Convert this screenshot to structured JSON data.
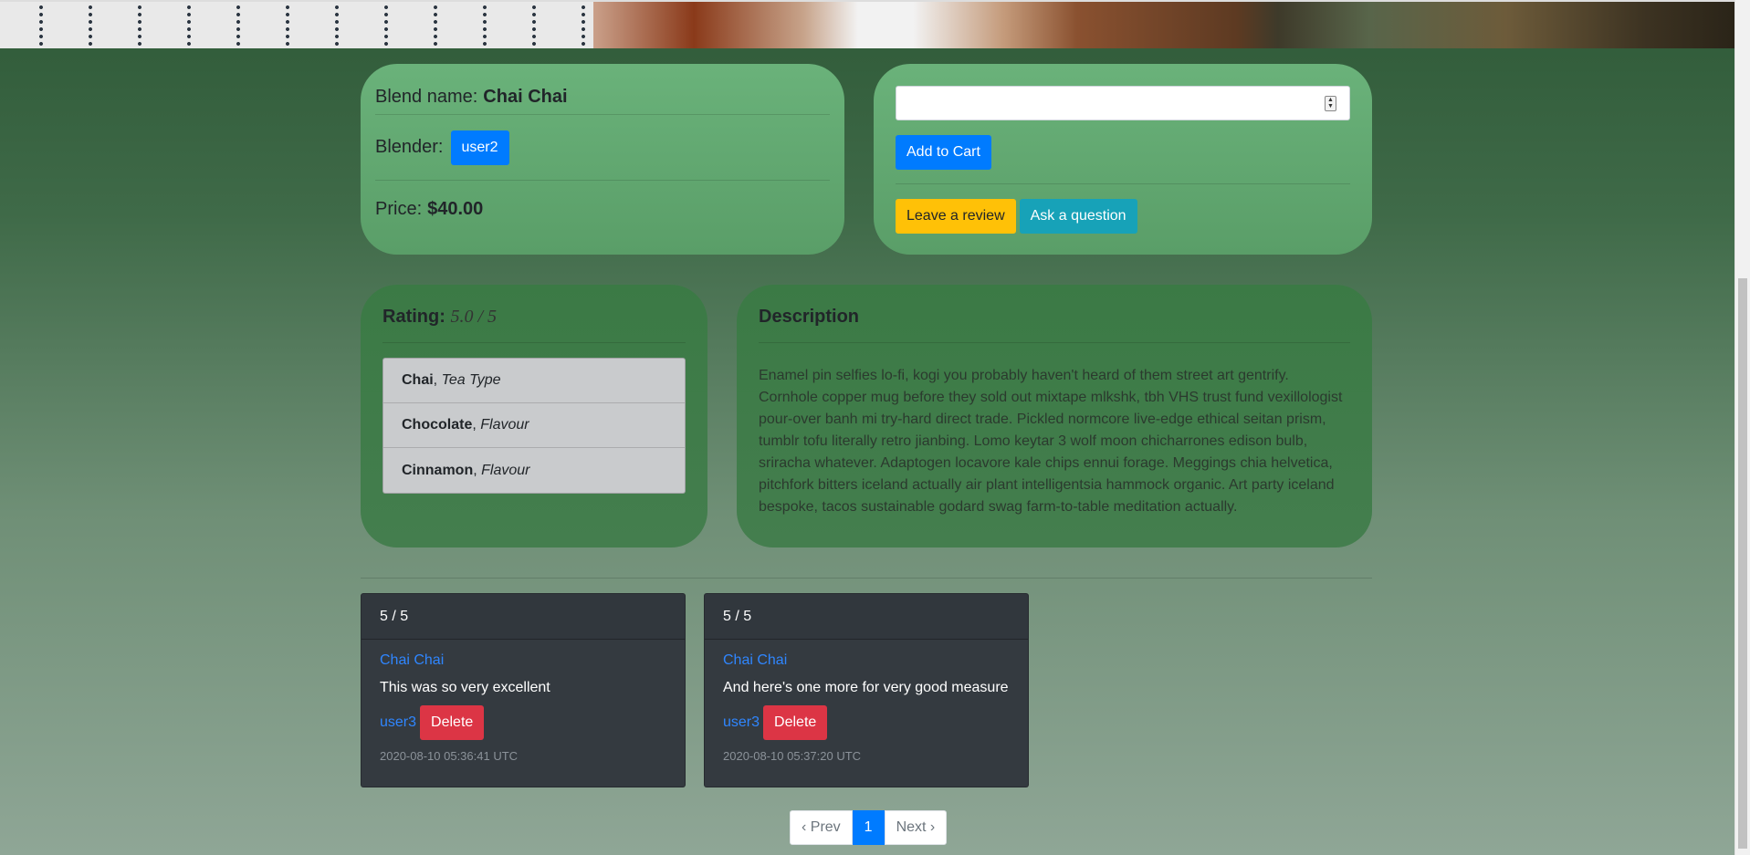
{
  "blend": {
    "name_label": "Blend name:",
    "name": "Chai Chai",
    "blender_label": "Blender:",
    "blender": "user2",
    "price_label": "Price:",
    "price": "$40.00"
  },
  "cart": {
    "quantity_value": "",
    "add_label": "Add to Cart",
    "review_label": "Leave a review",
    "question_label": "Ask a question"
  },
  "rating": {
    "label": "Rating",
    "value": "5.0 / 5",
    "flavours": [
      {
        "name": "Chai",
        "type": "Tea Type"
      },
      {
        "name": "Chocolate",
        "type": "Flavour"
      },
      {
        "name": "Cinnamon",
        "type": "Flavour"
      }
    ]
  },
  "description": {
    "title": "Description",
    "text": "Enamel pin selfies lo-fi, kogi you probably haven't heard of them street art gentrify. Cornhole copper mug before they sold out mixtape mlkshk, tbh VHS trust fund vexillologist pour-over banh mi try-hard direct trade. Pickled normcore live-edge ethical seitan prism, tumblr tofu literally retro jianbing. Lomo keytar 3 wolf moon chicharrones edison bulb, sriracha whatever. Adaptogen locavore kale chips ennui forage. Meggings chia helvetica, pitchfork bitters iceland actually air plant intelligentsia hammock organic. Art party iceland bespoke, tacos sustainable godard swag farm-to-table meditation actually."
  },
  "reviews": [
    {
      "score": "5 / 5",
      "blend": "Chai Chai",
      "text": "This was so very excellent",
      "author": "user3",
      "delete_label": "Delete",
      "timestamp": "2020-08-10 05:36:41 UTC"
    },
    {
      "score": "5 / 5",
      "blend": "Chai Chai",
      "text": "And here's one more for very good measure",
      "author": "user3",
      "delete_label": "Delete",
      "timestamp": "2020-08-10 05:37:20 UTC"
    }
  ],
  "pagination": {
    "prev": "‹ Prev",
    "current": "1",
    "next": "Next ›"
  },
  "colors": {
    "primary": "#007bff",
    "warning": "#ffc107",
    "info": "#17a2b8",
    "danger": "#dc3545",
    "panel_green": "#6ab27a",
    "card_dark": "#343a40"
  }
}
